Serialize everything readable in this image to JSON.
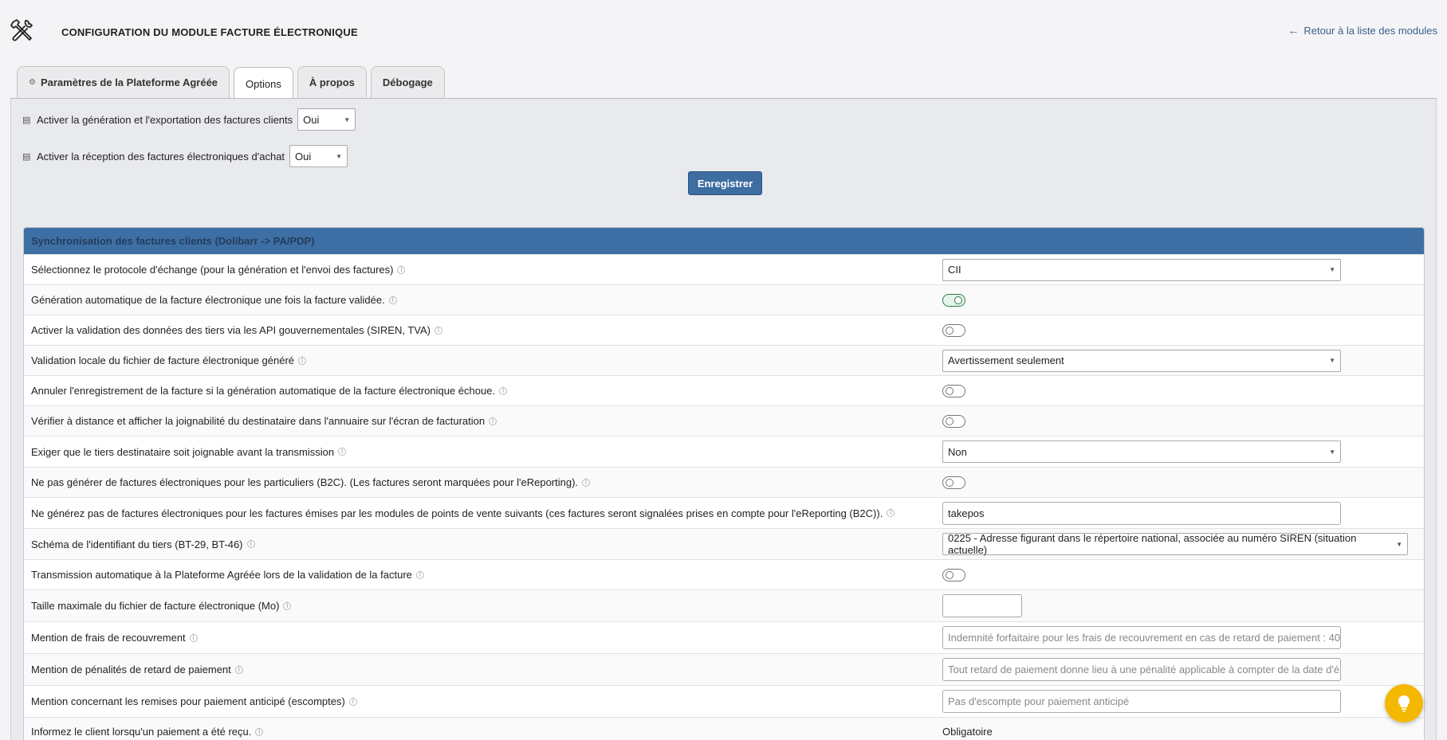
{
  "header": {
    "title": "CONFIGURATION DU MODULE FACTURE ÉLECTRONIQUE",
    "back_link": "Retour à la liste des modules",
    "icon": "tools-icon"
  },
  "tabs": [
    {
      "label": "Paramètres de la Plateforme Agréée",
      "active": false
    },
    {
      "label": "Options",
      "active": true
    },
    {
      "label": "À propos",
      "active": false
    },
    {
      "label": "Débogage",
      "active": false
    }
  ],
  "options": {
    "export_label": "Activer la génération et l'exportation des factures clients",
    "export_value": "Oui",
    "reception_label": "Activer la réception des factures électroniques d'achat",
    "reception_value": "Oui",
    "save_label": "Enregistrer"
  },
  "table": {
    "header": "Synchronisation des factures clients (Dolibarr -> PA/PDP)",
    "rows": [
      {
        "label": "Sélectionnez le protocole d'échange (pour la génération et l'envoi des factures)",
        "value": "CII"
      },
      {
        "label": "Génération automatique de la facture électronique une fois la facture validée.",
        "value": "on"
      },
      {
        "label": "Activer la validation des données des tiers via les API gouvernementales (SIREN, TVA)",
        "value": "off"
      },
      {
        "label": "Validation locale du fichier de facture électronique généré",
        "value": "Avertissement seulement"
      },
      {
        "label": "Annuler l'enregistrement de la facture si la génération automatique de la facture électronique échoue.",
        "value": "off"
      },
      {
        "label": "Vérifier à distance et afficher la joignabilité du destinataire dans l'annuaire sur l'écran de facturation",
        "value": "off"
      },
      {
        "label": "Exiger que le tiers destinataire soit joignable avant la transmission",
        "value": "Non"
      },
      {
        "label": "Ne pas générer de factures électroniques pour les particuliers (B2C). (Les factures seront marquées pour l'eReporting).",
        "value": "off"
      },
      {
        "label": "Ne générez pas de factures électroniques pour les factures émises par les modules de points de vente suivants (ces factures seront signalées prises en compte pour l'eReporting (B2C)).",
        "value": "takepos"
      },
      {
        "label": "Schéma de l'identifiant du tiers (BT-29, BT-46)",
        "value": "0225 - Adresse figurant dans le répertoire national, associée au numéro SIREN (situation actuelle)"
      },
      {
        "label": "Transmission automatique à la Plateforme Agréée lors de la validation de la facture",
        "value": "off"
      },
      {
        "label": "Taille maximale du fichier de facture électronique (Mo)",
        "value": ""
      },
      {
        "label": "Mention de frais de recouvrement",
        "value": "Indemnité forfaitaire pour les frais de recouvrement en cas de retard de paiement : 40"
      },
      {
        "label": "Mention de pénalités de retard de paiement",
        "value": "Tout retard de paiement donne lieu à une pénalité applicable à compter de la date d'é"
      },
      {
        "label": "Mention concernant les remises pour paiement anticipé (escomptes)",
        "value": "Pas d'escompte pour paiement anticipé"
      },
      {
        "label": "Informez le client lorsqu'un paiement a été reçu.",
        "value": "Obligatoire"
      }
    ]
  },
  "colors": {
    "accent": "#3e6fa4",
    "button": "#3d6da1",
    "toggle_on": "#2e7d4a",
    "fab": "#f5b800"
  }
}
